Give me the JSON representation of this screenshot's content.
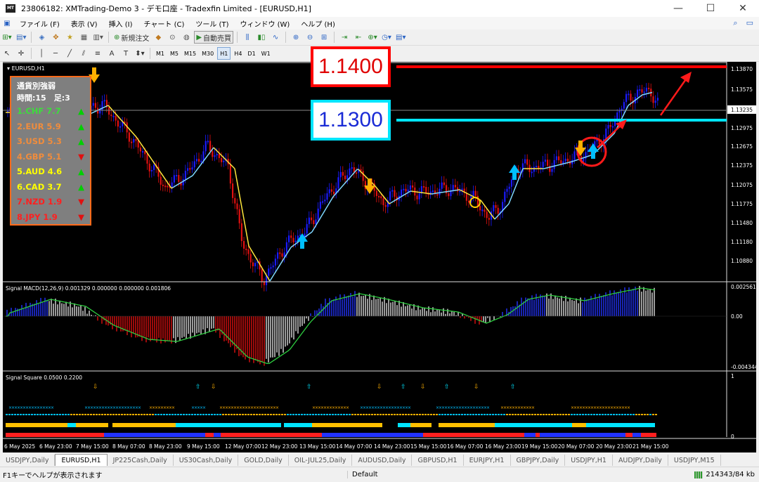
{
  "window": {
    "title": "23806182: XMTrading-Demo 3 - デモ口座 - Tradexfin Limited - [EURUSD,H1]",
    "minimize_glyph": "—",
    "maximize_glyph": "☐",
    "close_glyph": "✕"
  },
  "menu": {
    "items": [
      "ファイル (F)",
      "表示 (V)",
      "挿入 (I)",
      "チャート (C)",
      "ツール (T)",
      "ウィンドウ (W)",
      "ヘルプ (H)"
    ]
  },
  "toolbar": {
    "new_order_label": "新規注文",
    "auto_trading_label": "自動売買"
  },
  "periods": [
    "M1",
    "M5",
    "M15",
    "M30",
    "H1",
    "H4",
    "D1",
    "W1"
  ],
  "active_period": "H1",
  "chart": {
    "symbol_label": "EURUSD,H1",
    "price_axis": [
      "1.13870",
      "1.13575",
      "1.13235",
      "1.12975",
      "1.12675",
      "1.12375",
      "1.12075",
      "1.11775",
      "1.11480",
      "1.11180",
      "1.10880"
    ],
    "current_price": "1.13235",
    "label_high": "1.1400",
    "label_mid": "1.1300",
    "time_axis": [
      "6 May 2025",
      "6 May 23:00",
      "7 May 15:00",
      "8 May 07:00",
      "8 May 23:00",
      "9 May 15:00",
      "12 May 07:00",
      "12 May 23:00",
      "13 May 15:00",
      "14 May 07:00",
      "14 May 23:00",
      "15 May 15:00",
      "16 May 07:00",
      "16 May 23:00",
      "19 May 15:00",
      "20 May 07:00",
      "20 May 23:00",
      "21 May 15:00"
    ]
  },
  "strength_panel": {
    "title": "通貨別強弱",
    "subtitle": "時間:15　足:3",
    "rows": [
      {
        "label": "1.CHF  7.7",
        "color": "#3ddc3d",
        "arrow": "▲",
        "arrow_color": "#00d000"
      },
      {
        "label": "2.EUR  5.9",
        "color": "#f08c3c",
        "arrow": "▲",
        "arrow_color": "#00d000"
      },
      {
        "label": "3.USD  5.3",
        "color": "#f08c3c",
        "arrow": "▲",
        "arrow_color": "#00d000"
      },
      {
        "label": "4.GBP  5.1",
        "color": "#f08c3c",
        "arrow": "▼",
        "arrow_color": "#e01010"
      },
      {
        "label": "5.AUD  4.6",
        "color": "#ffff00",
        "arrow": "▲",
        "arrow_color": "#00d000"
      },
      {
        "label": "6.CAD  3.7",
        "color": "#ffff00",
        "arrow": "▲",
        "arrow_color": "#00d000"
      },
      {
        "label": "7.NZD  1.9",
        "color": "#ff2020",
        "arrow": "▼",
        "arrow_color": "#e01010"
      },
      {
        "label": "8.JPY  1.9",
        "color": "#ff2020",
        "arrow": "▼",
        "arrow_color": "#e01010"
      }
    ]
  },
  "macd": {
    "label": "Signal MACD(12,26,9) 0.001329 0.000000 0.000000 0.001806",
    "axis": [
      "0.002561",
      "0.00",
      "-0.004344"
    ]
  },
  "square": {
    "label": "Signal Square 0.0500 0.2200",
    "axis": [
      "1",
      "0"
    ]
  },
  "tabs": [
    "USDJPY,Daily",
    "EURUSD,H1",
    "JP225Cash,Daily",
    "US30Cash,Daily",
    "GOLD,Daily",
    "OIL-JUL25,Daily",
    "AUDUSD,Daily",
    "GBPUSD,H1",
    "EURJPY,H1",
    "GBPJPY,Daily",
    "USDJPY,H1",
    "AUDJPY,Daily",
    "USDJPY,M15"
  ],
  "active_tab": "EURUSD,H1",
  "status": {
    "help": "F1キーでヘルプが表示されます",
    "profile": "Default",
    "traffic": "214343/84 kb"
  },
  "colors": {
    "bull": "#1a1aff",
    "bear": "#e01010",
    "ma_up": "#7ed6ff",
    "ma_down": "#ffe63c",
    "level_high": "#ff0000",
    "level_mid": "#00e5ff"
  }
}
